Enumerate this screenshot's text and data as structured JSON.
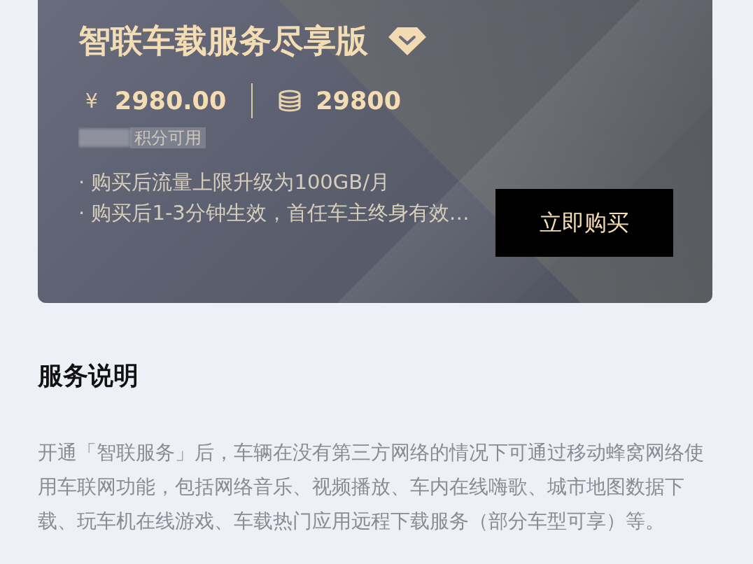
{
  "card": {
    "title": "智联车载服务尽享版",
    "price": "2980.00",
    "currency": "¥",
    "points": "29800",
    "points_note": "积分可用",
    "bullets": [
      "· 购买后流量上限升级为100GB/月",
      "· 购买后1-3分钟生效，首任车主终身有效…"
    ],
    "buy_button": "立即购买"
  },
  "section": {
    "heading": "服务说明",
    "body": "开通「智联服务」后，车辆在没有第三方网络的情况下可通过移动蜂窝网络使用车联网功能，包括网络音乐、视频播放、车内在线嗨歌、城市地图数据下载、玩车机在线游戏、车载热门应用远程下载服务（部分车型可享）等。"
  }
}
